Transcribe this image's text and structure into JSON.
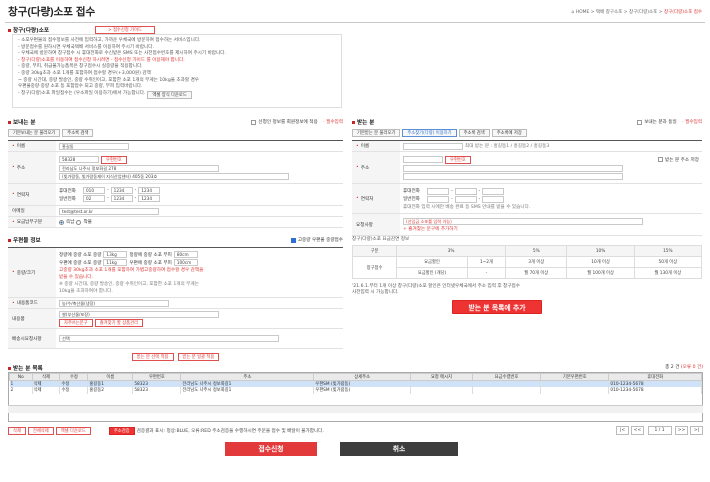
{
  "header": {
    "title": "창구(다량)소포 접수",
    "breadcrumb": [
      "HOME",
      "택배 창구소포",
      "창구(다량)소포",
      "창구(다량)소포 접수"
    ]
  },
  "guide_button": "> 접수신청 가이드",
  "intro": {
    "title": "창구(다량)소포",
    "lines": [
      "- 소포우편물의 접수정보를 사전에 입력하고, 가까운 우체국에 방문하여 접수하는 서비스입니다.",
      "- 방문접수를 원하시면 우체국택배 서비스를 이용하여 주시기 바랍니다.",
      "- 우체국에 방문하여 창구접수 시 휴대전화로 수신받은 SMS 또는 사전접수번호를 제시하여 주시기 바랍니다.",
      "- 창구(다량)소포를 이용하여 접수신청 하시려면 - 접수신청 가이드 를 이용해야 합니다.",
      "- 중량, 부피, 취급불가능품목은 창구접수시 실중량을 적용합니다.",
      "- 중량 30kg초과 소포 1개를 포함하여 접수할 경우(+3,000원) 감액",
      "  ~ 중량 시간대, 중량 발송인, 중량 수취인이고, 포함한 소포 1개의 무게는 10kg을 초과할 경우",
      "    우편물중량·중량 소포 등 포함접수 되고 중량, 부피 입력바랍니다.",
      "- 창구(다량)소포 파일접수는 (우소파일 이용하기)에서 가능합니다."
    ],
    "file_button": "엑셀 양식 다운로드"
  },
  "sender": {
    "title": "보내는 분",
    "consent_label": "신청인 정보를 회원정보에 적용",
    "required_note": "· 필수입력",
    "btn_load": "기본보내는 분 불러오기",
    "btn_addr": "주소록 검색",
    "name_label": "이름",
    "name_value": "홍길동",
    "addr_label": "주소",
    "zip": "58328",
    "zip_btn": "우편번호",
    "addr1": "전라남도 나주시 정보화길 278",
    "addr2": "(빛가람동, 빛가람동재이 지식산업센터) 405동 203호",
    "contact_label": "연락처",
    "mobile_label": "휴대전화",
    "mobile": [
      "010",
      "1234",
      "1234"
    ],
    "phone_label": "일반전화",
    "phone": [
      "02",
      "1234",
      "1234"
    ],
    "email_label": "이메일",
    "email": "test@test.or.kr",
    "prepaid_label": "요금납부구분",
    "pay_opt1": "즉납",
    "pay_opt2": "착불"
  },
  "receiver": {
    "title": "받는 분",
    "same_label": "보내는 분과 동일",
    "required_note": "· 필수입력",
    "btn_load": "기본받는 분 불러오기",
    "btn_recent": "주소찾기(다량) 이용하기",
    "btn_addr": "주소록 검색",
    "btn_save": "주소록에 저장",
    "name_label": "이름",
    "name_hint": "최대 받는 분 : 홍길동1 / 홍길동2 / 홍길동3",
    "addr_label": "주소",
    "zip_btn": "우편번호",
    "save_addr": "받는 분 주소 저장",
    "contact_label": "연락처",
    "mobile_label": "휴대전화",
    "phone_label": "일반전화",
    "sms_note": "휴대전화 입력 시에만 배송 완료 등 SMS 안내를 받을 수 있습니다.",
    "memo_label": "요청사항",
    "memo_hint": "(선입금 소포를 입력 가능)",
    "memo_btn": "+ 즐겨찾는 문구에 추가하기"
  },
  "parcel": {
    "title": "우편물 정보",
    "insure_label": "고중량 우편물 중량접수",
    "weight_label": "중량/크기",
    "w1": "정량에 중량 소포 중량",
    "w1v": "13kg",
    "w2": "정량에 중량 소포 부피",
    "w2v": "80cm",
    "w3": "우편에 중량 소포 중량",
    "w3v": "11kg",
    "w4": "우편에 중량 소포 부피",
    "w4v": "100cm",
    "w_note1": "고중량 30kg초과 소포 1개를 포함하여 가볍고중량하여 접수할 경우 감액을",
    "w_note2": "받을 수 있습니다.",
    "w_note3": "※ 중량 시간대, 중량 발송인, 중량 수취인이고, 포함한 소포 1개의 무게는",
    "w_note4": "10kg을 초과하여야 합니다.",
    "content_label": "내용품코드",
    "content_value": "농/수/축산물(냉장)",
    "content_name_label": "내용품",
    "content_name_value": "쌀(부산물/포장)",
    "content_btn1": "자주쓰는문구",
    "content_btn2": "즐겨찾기 할 상품관리",
    "memo_label": "배송시요청사항",
    "memo_value": "선택",
    "btn_apply1": "받는 분 선택 적용",
    "btn_apply2": "받는 분 일괄 적용"
  },
  "rates": {
    "title": "창구(다량)소포 요금감면 정보",
    "headers": [
      "구분",
      "3%",
      "5%",
      "10%",
      "15%"
    ],
    "row_label": "창구접수",
    "row1_label": "요금할인",
    "row1": [
      "1~2개",
      "3개 이상",
      "10개 이상",
      "50개 이상"
    ],
    "row2_label": "요금할인\n(개당)",
    "row2": [
      "-",
      "월 70개 이상",
      "월 100개 이상",
      "월 130개 이상"
    ],
    "note": "'21.6.1.부터 1개 이상 창구(다량)소포 할인은 인터넷우체국에서 주소 입력 후 창구접수",
    "note2": "사전입력 시 가능합니다.",
    "add_button": "받는 분 목록에 추가"
  },
  "list": {
    "title": "받는 분 목록",
    "count_text": "총 2 건",
    "err_text": "(오류 0 건)",
    "columns": [
      "No",
      "삭제",
      "수정",
      "이름",
      "우편번호",
      "주소",
      "상세주소",
      "요청 메시지",
      "요금수령번호",
      "기본우편번호",
      "휴대전화"
    ],
    "rows": [
      [
        "1",
        "삭제",
        "수정",
        "홍길동1",
        "58323",
        "전라남도 나주시 정보화길1",
        "우편SM (빛가람동)",
        "",
        "",
        "",
        "010-1234-5678"
      ],
      [
        "2",
        "삭제",
        "수정",
        "홍길동2",
        "58323",
        "전라남도 나주시 정보화길1",
        "우편SM (빛가람동)",
        "",
        "",
        "",
        "010-1234-5678"
      ]
    ]
  },
  "footer": {
    "del": "삭제",
    "del_all": "전체삭제",
    "excel": "엑셀 다운로드",
    "addr_check": "주소검증",
    "legend": "검증결과 표시: 정상:BLUE, 오류:RED  주소검증을 수행하시면 주문을 접수 및 배달이 불가합니다.",
    "page": "1 / 1",
    "submit": "접수신청",
    "cancel": "취소"
  },
  "colors": {
    "accent": "#e23a3a",
    "blue": "#2a6fd6",
    "dark": "#3d3d3d"
  }
}
